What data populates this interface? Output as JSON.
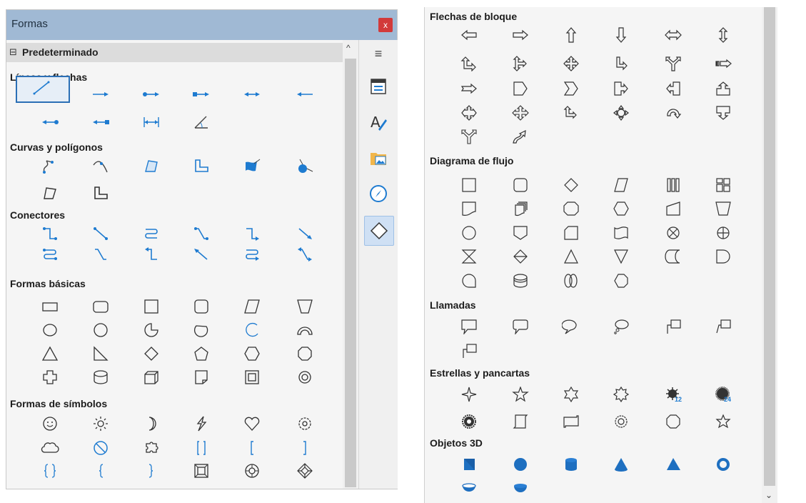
{
  "panel": {
    "title": "Formas",
    "close_label": "x",
    "section_toggle": "⊟",
    "section_label": "Predeterminado",
    "scroll_up": "^",
    "menu_icon": "≡"
  },
  "groups": {
    "lineas": "Líneas y flechas",
    "curvas": "Curvas y polígonos",
    "conectores": "Conectores",
    "basicas": "Formas básicas",
    "simbolos": "Formas de símbolos",
    "flechas_bloque": "Flechas de bloque",
    "diagrama": "Diagrama de flujo",
    "llamadas": "Llamadas",
    "estrellas": "Estrellas y pancartas",
    "objetos3d": "Objetos 3D"
  },
  "badges": {
    "star12": "12",
    "star24": "24"
  },
  "right_scroll_arrow": "⌄",
  "colors": {
    "accent": "#1e7bd0",
    "titlebar": "#a0b9d4",
    "close": "#d23a3a"
  }
}
